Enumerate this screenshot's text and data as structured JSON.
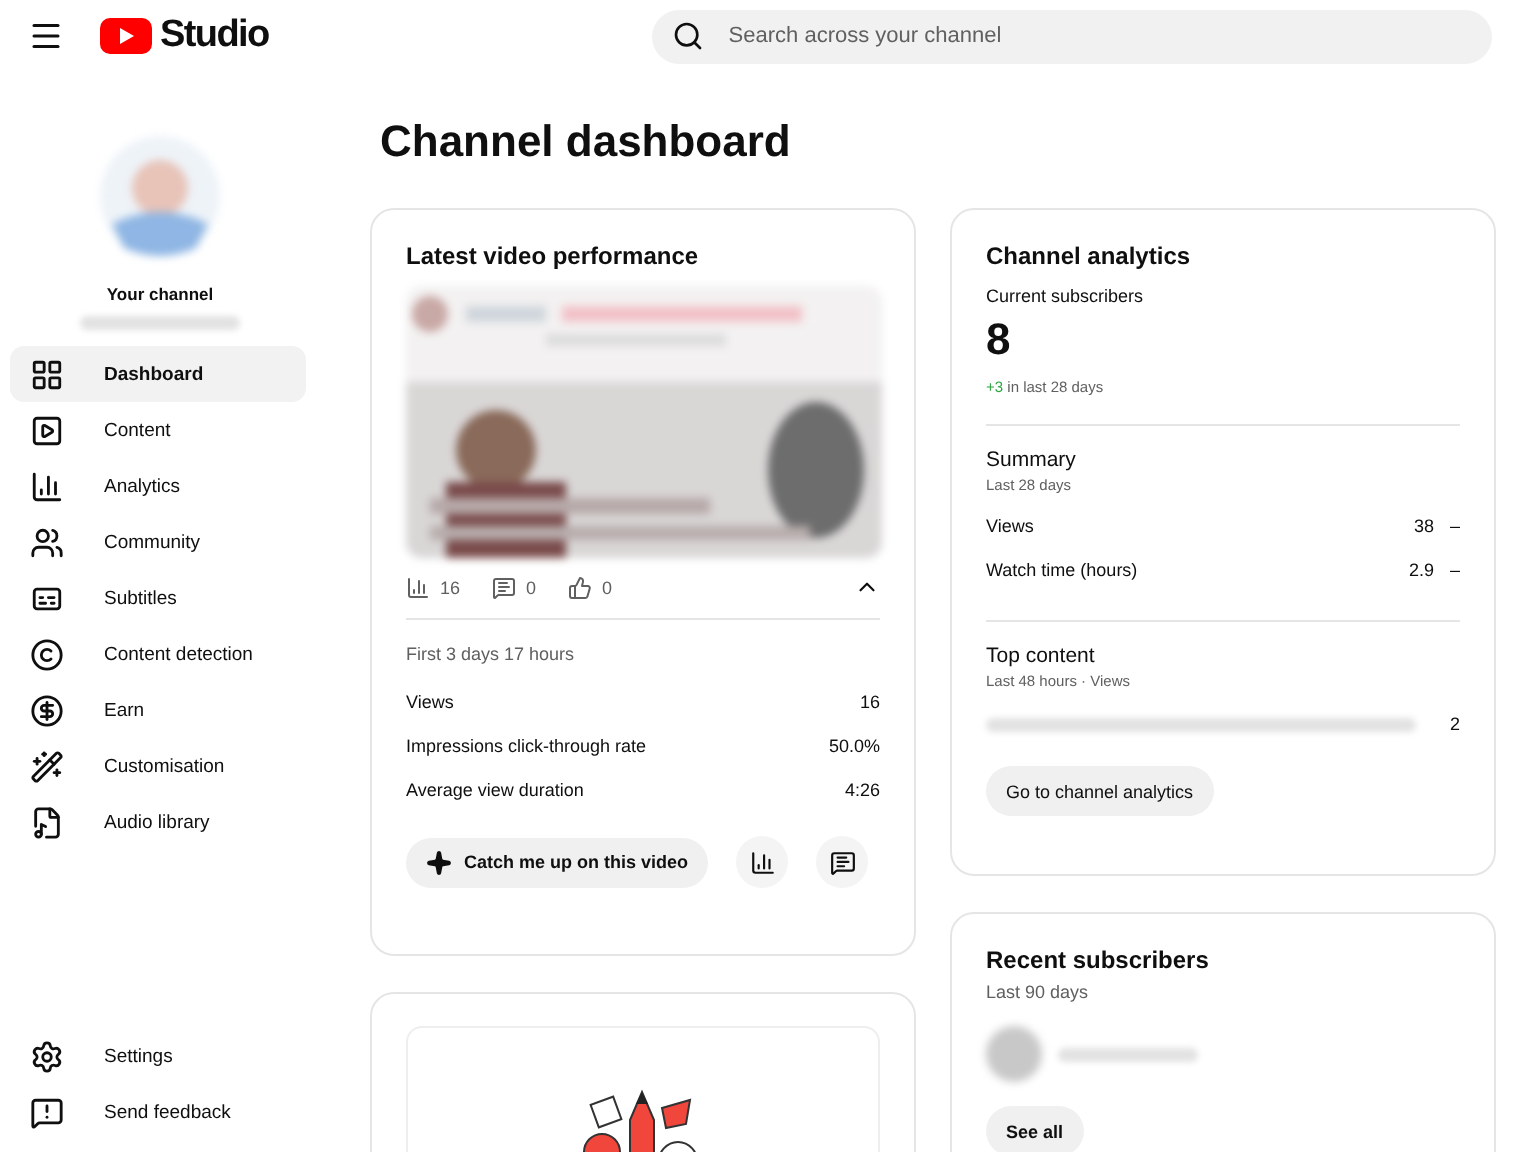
{
  "header": {
    "logo_text": "Studio",
    "search": {
      "placeholder": "Search across your channel"
    }
  },
  "channel": {
    "label": "Your channel"
  },
  "nav": [
    {
      "label": "Dashboard",
      "selected": true
    },
    {
      "label": "Content",
      "selected": false
    },
    {
      "label": "Analytics",
      "selected": false
    },
    {
      "label": "Community",
      "selected": false
    },
    {
      "label": "Subtitles",
      "selected": false
    },
    {
      "label": "Content detection",
      "selected": false
    },
    {
      "label": "Earn",
      "selected": false
    },
    {
      "label": "Customisation",
      "selected": false
    },
    {
      "label": "Audio library",
      "selected": false
    }
  ],
  "nav_bottom": [
    {
      "label": "Settings"
    },
    {
      "label": "Send feedback"
    }
  ],
  "page_title": "Channel dashboard",
  "latest_video": {
    "title": "Latest video performance",
    "stats": [
      {
        "value": "16"
      },
      {
        "value": "0"
      },
      {
        "value": "0"
      }
    ],
    "expanded": true,
    "period": "First 3 days 17 hours",
    "metrics": [
      {
        "label": "Views",
        "value": "16"
      },
      {
        "label": "Impressions click-through rate",
        "value": "50.0%"
      },
      {
        "label": "Average view duration",
        "value": "4:26"
      }
    ],
    "action": "Catch me up on this video"
  },
  "analytics": {
    "title": "Channel analytics",
    "subscribers_label": "Current subscribers",
    "subscribers": "8",
    "change": "+3",
    "change_text": "in last 28 days",
    "summary_title": "Summary",
    "summary_period": "Last 28 days",
    "summary": [
      {
        "label": "Views",
        "value": "38",
        "trend": "–"
      },
      {
        "label": "Watch time (hours)",
        "value": "2.9",
        "trend": "–"
      }
    ],
    "top_title": "Top content",
    "top_period": "Last 48 hours · Views",
    "top_items": [
      {
        "value": "2"
      }
    ],
    "button": "Go to channel analytics"
  },
  "recent_subscribers": {
    "title": "Recent subscribers",
    "period": "Last 90 days",
    "button": "See all"
  }
}
